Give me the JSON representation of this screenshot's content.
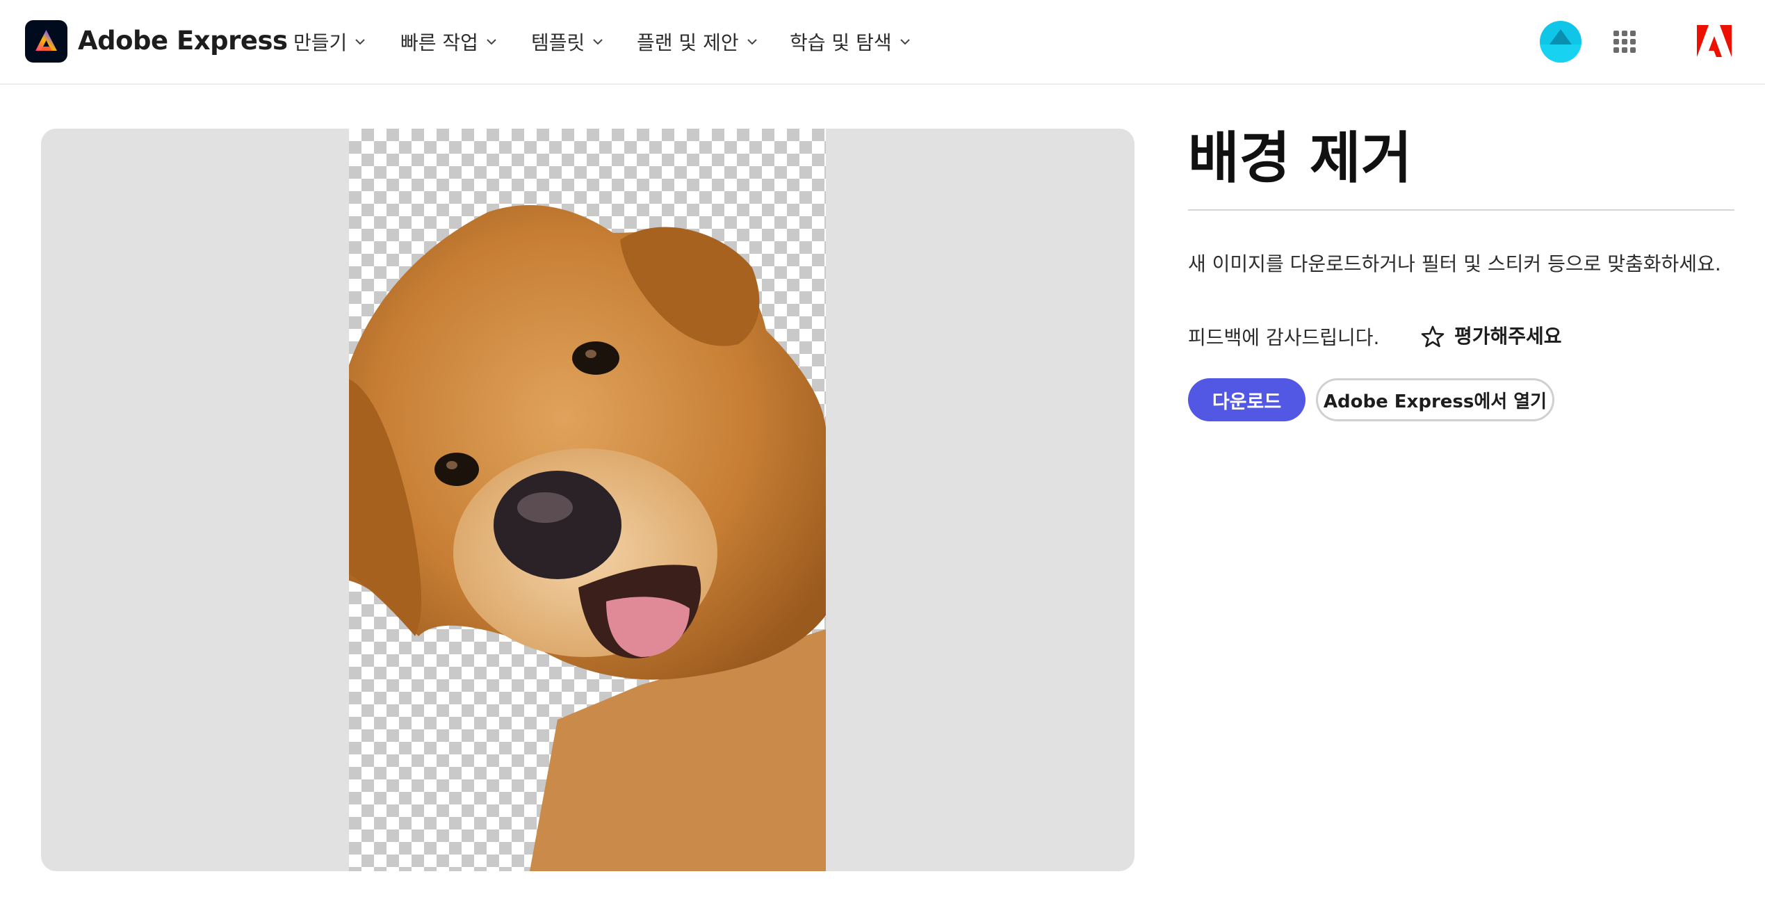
{
  "header": {
    "brand": "Adobe Express",
    "nav": [
      {
        "label": "만들기"
      },
      {
        "label": "빠른 작업"
      },
      {
        "label": "템플릿"
      },
      {
        "label": "플랜 및 제안"
      },
      {
        "label": "학습 및 탐색"
      }
    ],
    "icons": {
      "logo": "adobe-express-logo-icon",
      "avatar": "user-avatar",
      "apps": "apps-grid-icon",
      "adobe": "adobe-logo-icon"
    }
  },
  "preview": {
    "image": "dog-cutout-image",
    "background": "transparency-checkerboard"
  },
  "panel": {
    "title": "배경 제거",
    "description": "새 이미지를 다운로드하거나 필터 및 스티커 등으로 맞춤화하세요.",
    "feedback_thanks": "피드백에 감사드립니다.",
    "rate_label": "평가해주세요",
    "download_label": "다운로드",
    "open_label": "Adobe Express에서 열기"
  },
  "colors": {
    "primary": "#5258e4",
    "preview_bg": "#e1e1e1",
    "adobe_red": "#eb1000",
    "avatar": "#10c6e8"
  }
}
